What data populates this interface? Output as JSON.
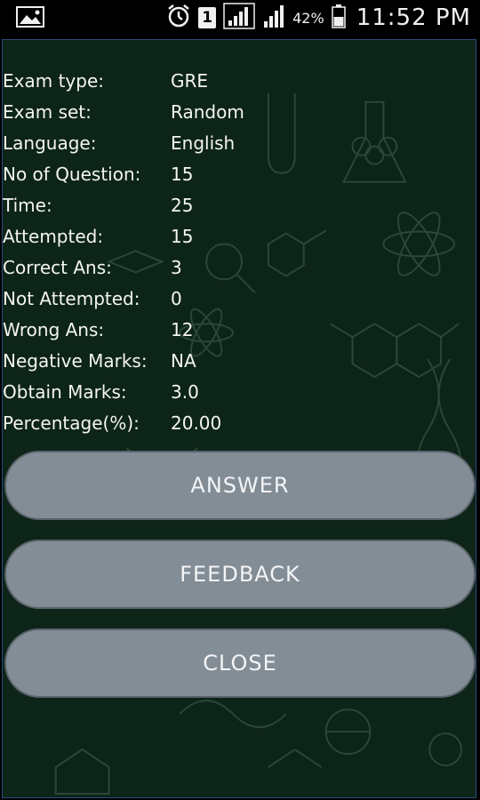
{
  "status_bar": {
    "time": "11:52 PM",
    "battery_percent": "42%",
    "sim_slot": "1",
    "icons": [
      "gallery-icon",
      "alarm-icon",
      "sim-icon",
      "signal-icon",
      "signal-icon-2",
      "battery-icon"
    ]
  },
  "result": {
    "rows": [
      {
        "label": "Exam type:",
        "value": "GRE"
      },
      {
        "label": "Exam set:",
        "value": "Random"
      },
      {
        "label": "Language:",
        "value": "English"
      },
      {
        "label": "No of Question:",
        "value": "15"
      },
      {
        "label": "Time:",
        "value": "25"
      },
      {
        "label": "Attempted:",
        "value": "15"
      },
      {
        "label": "Correct Ans:",
        "value": "3"
      },
      {
        "label": "Not Attempted:",
        "value": "0"
      },
      {
        "label": "Wrong Ans:",
        "value": "12"
      },
      {
        "label": "Negative Marks:",
        "value": "NA"
      },
      {
        "label": "Obtain Marks:",
        "value": "3.0"
      },
      {
        "label": "Percentage(%):",
        "value": "20.00"
      }
    ]
  },
  "buttons": {
    "answer": "ANSWER",
    "feedback": "FEEDBACK",
    "close": "CLOSE"
  },
  "colors": {
    "background": "#0d2418",
    "button": "#838d96",
    "text": "#f4f4f4"
  }
}
